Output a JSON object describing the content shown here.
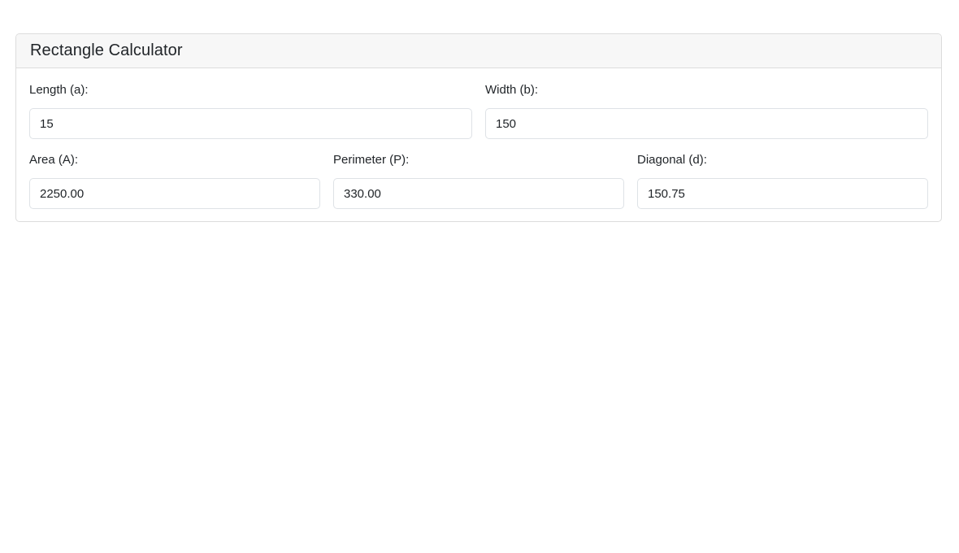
{
  "calculator": {
    "title": "Rectangle Calculator",
    "inputs": {
      "length": {
        "label": "Length (a):",
        "value": "15"
      },
      "width": {
        "label": "Width (b):",
        "value": "150"
      }
    },
    "results": {
      "area": {
        "label": "Area (A):",
        "value": "2250.00"
      },
      "perimeter": {
        "label": "Perimeter (P):",
        "value": "330.00"
      },
      "diagonal": {
        "label": "Diagonal (d):",
        "value": "150.75"
      }
    }
  }
}
